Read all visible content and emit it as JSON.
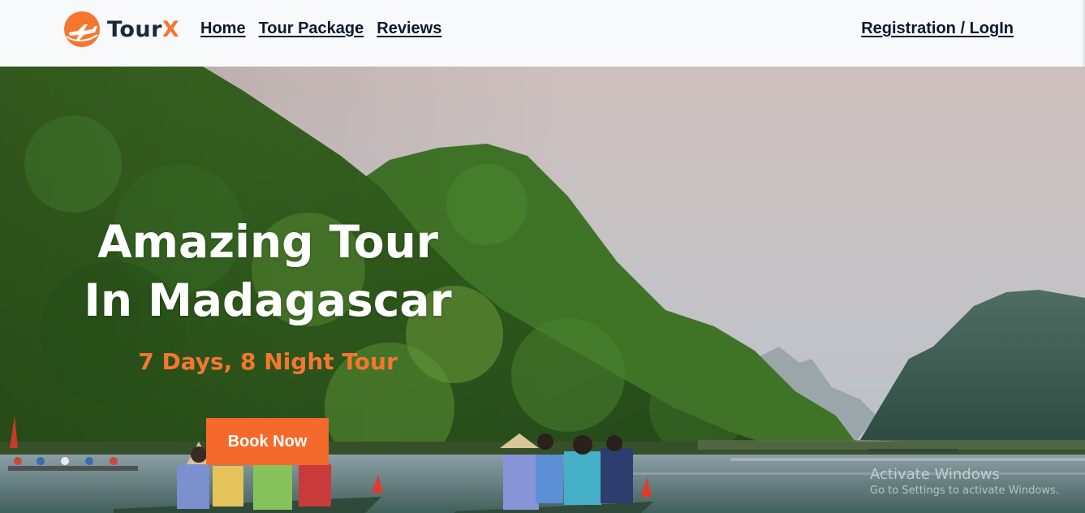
{
  "brand": {
    "name_part1": "Tour",
    "name_part2": "X",
    "logo_icon": "airplane-icon",
    "accent": "#f5772f"
  },
  "nav": {
    "items": [
      {
        "label": "Home"
      },
      {
        "label": "Tour Package"
      },
      {
        "label": "Reviews"
      }
    ],
    "auth_label": "Registration / LogIn"
  },
  "hero": {
    "title_line1": "Amazing Tour",
    "title_line2": "In Madagascar",
    "subtitle": "7 Days, 8 Night Tour",
    "cta_label": "Book Now",
    "cta_color": "#f5692a"
  },
  "watermark": {
    "line1": "Activate Windows",
    "line2": "Go to Settings to activate Windows."
  }
}
